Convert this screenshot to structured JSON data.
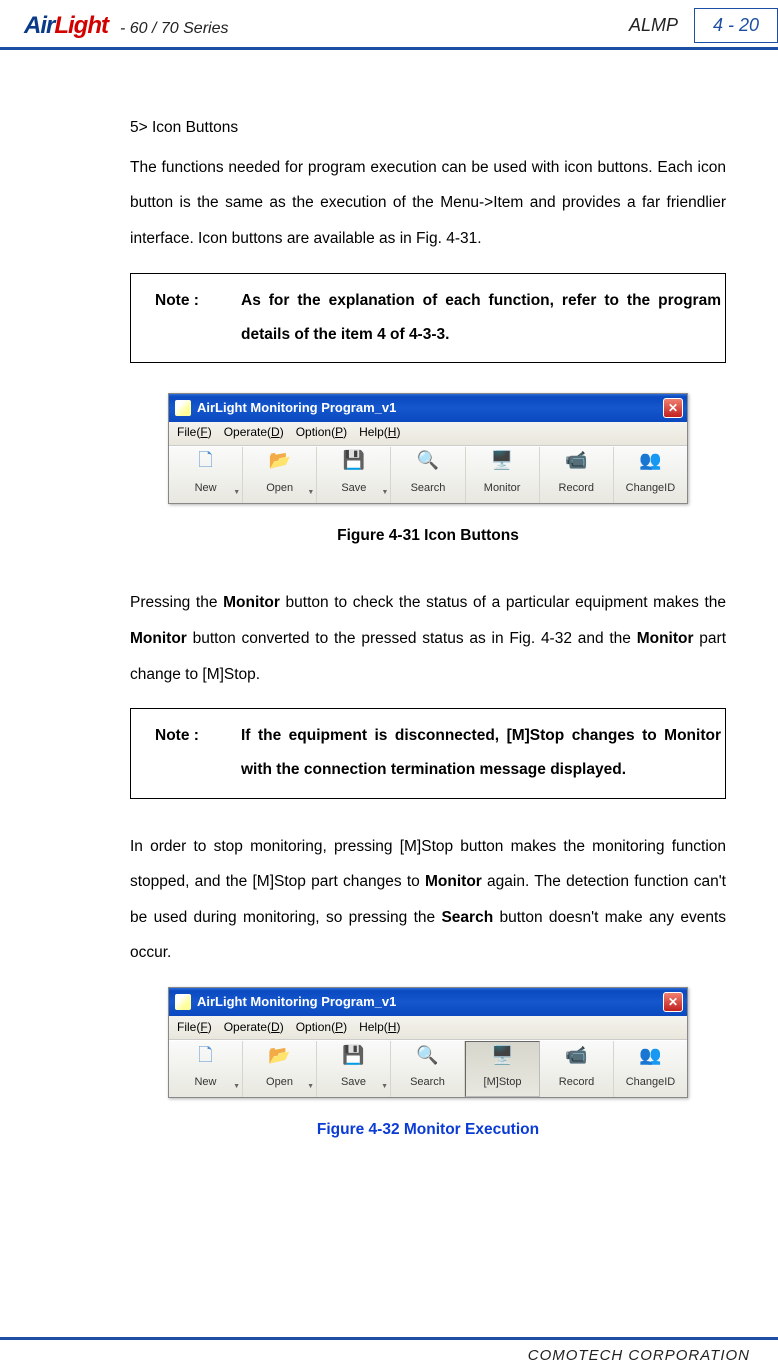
{
  "header": {
    "logo_air": "Air",
    "logo_light": "Light",
    "series": "- 60 / 70 Series",
    "almp": "ALMP",
    "page_num": "4 - 20"
  },
  "body": {
    "section_title": "5> Icon Buttons",
    "para1": "The functions needed for program execution can be used with icon buttons. Each icon button is the same as the execution of the Menu->Item and provides a far friendlier interface. Icon buttons are available as in Fig. 4-31.",
    "note1_label": "Note :",
    "note1_text": "As for the explanation of each function, refer to the program details of the item 4 of 4-3-3.",
    "fig1_caption": "Figure 4-31 Icon Buttons",
    "para2_pre": "Pressing the ",
    "para2_b1": "Monitor",
    "para2_mid1": " button to check the status of a particular equipment makes the ",
    "para2_b2": "Monitor",
    "para2_mid2": " button converted to the pressed status as in Fig. 4-32 and the ",
    "para2_b3": "Monitor",
    "para2_end": " part change to [M]Stop.",
    "note2_label": "Note :",
    "note2_text": "If the equipment is disconnected, [M]Stop changes to Monitor with the connection termination message displayed.",
    "para3_pre": "In order to stop monitoring, pressing [M]Stop button makes the monitoring function stopped, and the [M]Stop part changes to ",
    "para3_b1": "Monitor",
    "para3_mid": " again. The detection function can't be used during monitoring, so pressing the ",
    "para3_b2": "Search",
    "para3_end": " button doesn't make any events occur.",
    "fig2_caption": "Figure 4-32 Monitor Execution"
  },
  "window": {
    "title": "AirLight Monitoring Program_v1",
    "menu": {
      "file": "File(F)",
      "file_u": "F",
      "operate": "Operate(D)",
      "operate_u": "D",
      "option": "Option(P)",
      "option_u": "P",
      "help": "Help(H)",
      "help_u": "H"
    },
    "toolbar": {
      "new": "New",
      "open": "Open",
      "save": "Save",
      "search": "Search",
      "monitor": "Monitor",
      "mstop": "[M]Stop",
      "record": "Record",
      "changeid": "ChangeID"
    }
  },
  "footer": {
    "company": "COMOTECH CORPORATION"
  }
}
